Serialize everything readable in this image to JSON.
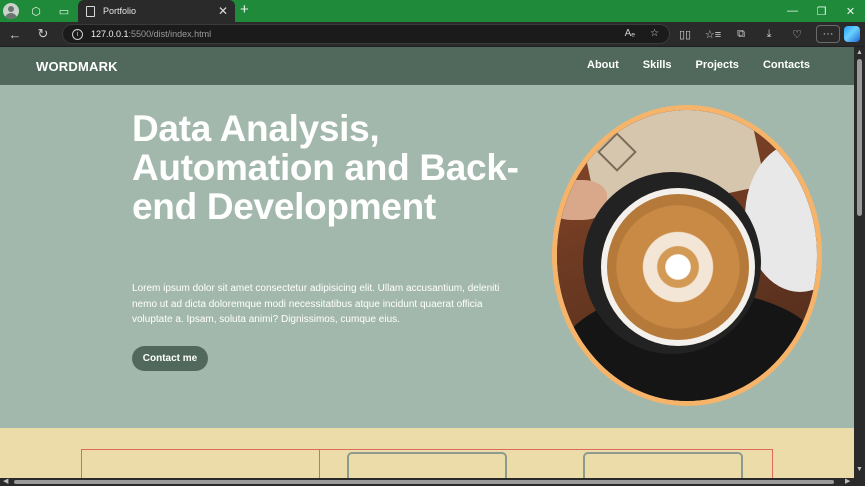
{
  "browser": {
    "tab_title": "Portfolio",
    "address_host": "127.0.0.1",
    "address_path": ":5500/dist/index.html",
    "icons": {
      "profile": "avatar-icon",
      "workspaces": "workspaces-icon",
      "tab_actions": "tab-actions-icon",
      "new_tab": "+",
      "minimize": "—",
      "maximize": "❐",
      "close": "✕",
      "back": "←",
      "reload": "↻",
      "read_aloud": "Aₑ",
      "favorite": "☆",
      "split": "▯▯",
      "favorites": "☆≡",
      "collections": "⧉",
      "downloads": "⤓",
      "health": "♡",
      "more": "···"
    }
  },
  "site": {
    "wordmark": "WORDMARK",
    "menu": [
      "About",
      "Skills",
      "Projects",
      "Contacts"
    ],
    "hero": {
      "title": "Data Analysis, Automation and Back-end Development",
      "paragraph": "Lorem ipsum dolor sit amet consectetur adipisicing elit. Ullam accusantium, deleniti nemo ut ad dicta doloremque modi necessitatibus atque incidunt quaerat officia voluptate a. Ipsam, soluta animi? Dignissimos, cumque eius.",
      "cta": "Contact me"
    },
    "colors": {
      "nav": "#51695c",
      "hero_bg": "#a3b8ad",
      "photo_ring": "#f5b46a",
      "section_bg": "#ecdcaa"
    }
  }
}
